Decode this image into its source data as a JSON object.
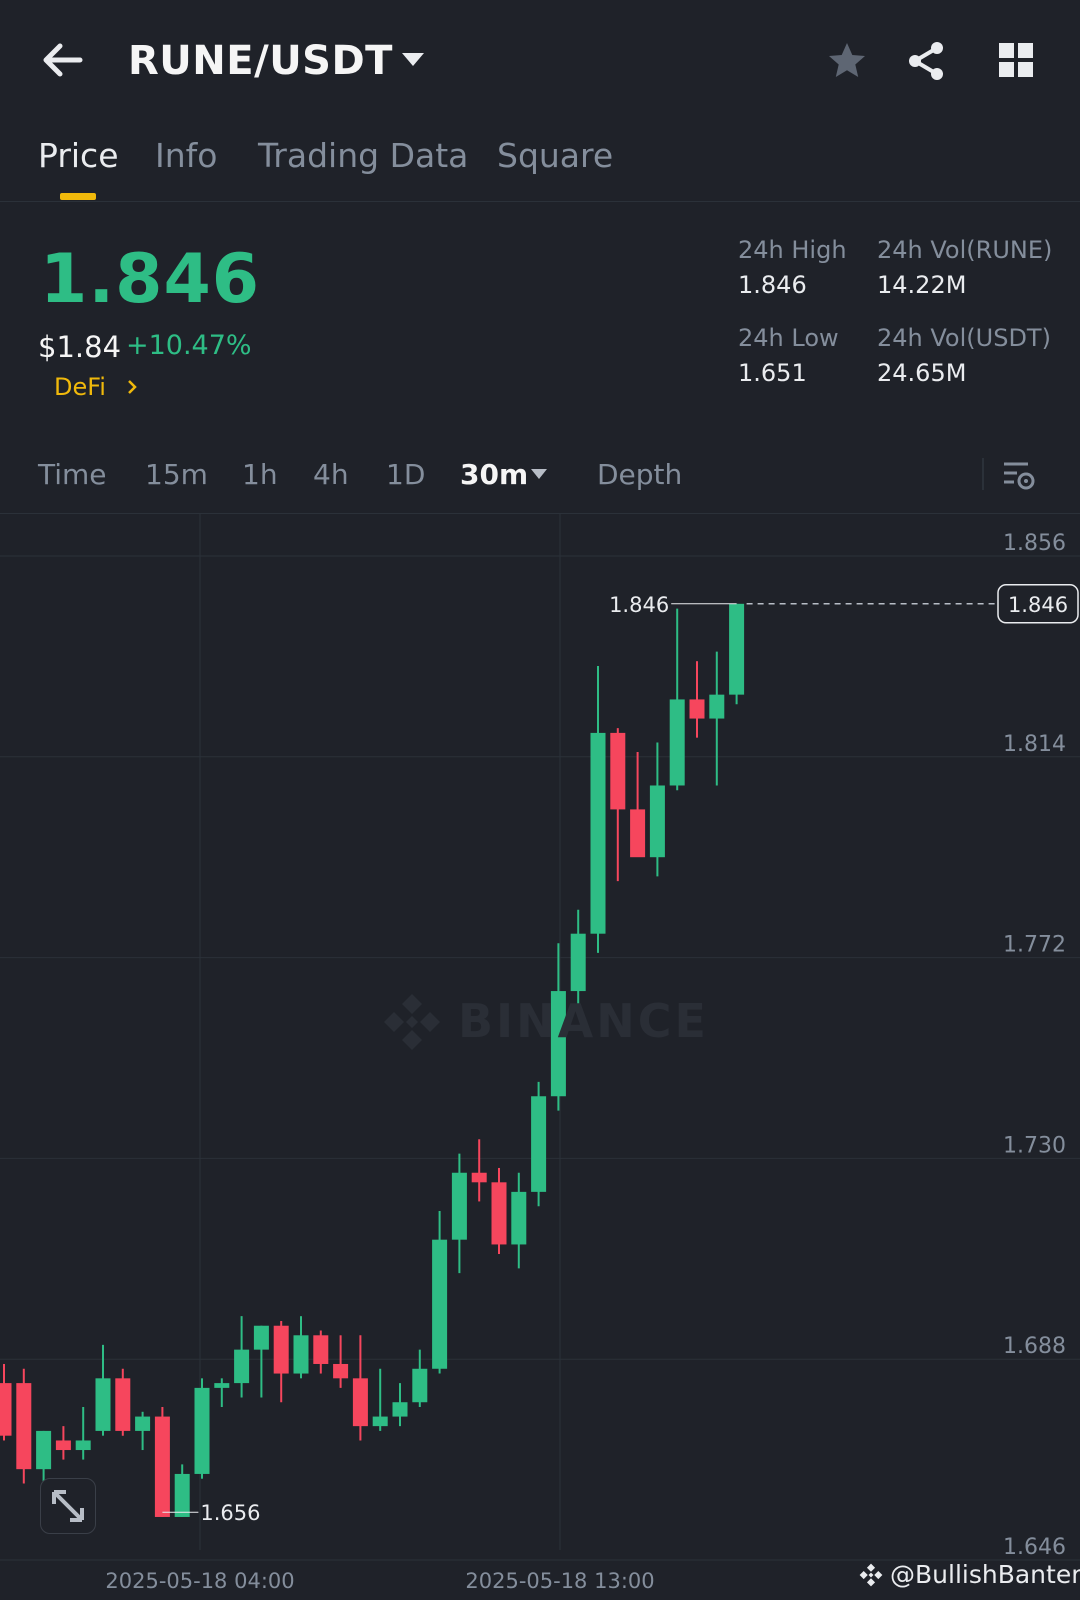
{
  "header": {
    "pair": "RUNE/USDT",
    "icons": [
      "back-arrow-icon",
      "caret-down-icon",
      "star-icon",
      "share-icon",
      "grid-icon"
    ]
  },
  "tabs": [
    {
      "label": "Price",
      "active": true
    },
    {
      "label": "Info",
      "active": false
    },
    {
      "label": "Trading Data",
      "active": false
    },
    {
      "label": "Square",
      "active": false
    }
  ],
  "price": {
    "last": "1.846",
    "usd": "$1.84",
    "change_pct": "+10.47%",
    "sector": "DeFi"
  },
  "stats": {
    "high_label": "24h High",
    "high_value": "1.846",
    "low_label": "24h Low",
    "low_value": "1.651",
    "vol_base_label": "24h Vol(RUNE)",
    "vol_base_value": "14.22M",
    "vol_quote_label": "24h Vol(USDT)",
    "vol_quote_value": "24.65M"
  },
  "intervals": {
    "time": "Time",
    "m15": "15m",
    "h1": "1h",
    "h4": "4h",
    "d1": "1D",
    "selected": "30m",
    "depth": "Depth"
  },
  "colors": {
    "up": "#2ebd85",
    "down": "#f6465d",
    "accent": "#f0b90b",
    "background": "#1f2229"
  },
  "watermark": "BINANCE",
  "credit": "@BullishBanter",
  "chart_data": {
    "type": "candlestick",
    "interval": "30m",
    "y_ticks": [
      "1.856",
      "1.814",
      "1.772",
      "1.730",
      "1.688",
      "1.646"
    ],
    "ylim": [
      1.646,
      1.856
    ],
    "x_labels": [
      "2025-05-18 04:00",
      "2025-05-18 13:00"
    ],
    "current_price_label": "1.846",
    "high_marker": "1.846",
    "low_marker": "1.656",
    "candles": [
      {
        "o": 1.683,
        "h": 1.687,
        "l": 1.671,
        "c": 1.672
      },
      {
        "o": 1.683,
        "h": 1.686,
        "l": 1.662,
        "c": 1.665
      },
      {
        "o": 1.665,
        "h": 1.673,
        "l": 1.661,
        "c": 1.673
      },
      {
        "o": 1.671,
        "h": 1.674,
        "l": 1.667,
        "c": 1.669
      },
      {
        "o": 1.669,
        "h": 1.678,
        "l": 1.667,
        "c": 1.671
      },
      {
        "o": 1.673,
        "h": 1.691,
        "l": 1.672,
        "c": 1.684
      },
      {
        "o": 1.684,
        "h": 1.686,
        "l": 1.672,
        "c": 1.673
      },
      {
        "o": 1.673,
        "h": 1.677,
        "l": 1.669,
        "c": 1.676
      },
      {
        "o": 1.676,
        "h": 1.678,
        "l": 1.655,
        "c": 1.655
      },
      {
        "o": 1.655,
        "h": 1.666,
        "l": 1.655,
        "c": 1.664
      },
      {
        "o": 1.664,
        "h": 1.684,
        "l": 1.663,
        "c": 1.682
      },
      {
        "o": 1.682,
        "h": 1.684,
        "l": 1.678,
        "c": 1.683
      },
      {
        "o": 1.683,
        "h": 1.697,
        "l": 1.68,
        "c": 1.69
      },
      {
        "o": 1.69,
        "h": 1.695,
        "l": 1.68,
        "c": 1.695
      },
      {
        "o": 1.695,
        "h": 1.696,
        "l": 1.679,
        "c": 1.685
      },
      {
        "o": 1.685,
        "h": 1.697,
        "l": 1.684,
        "c": 1.693
      },
      {
        "o": 1.693,
        "h": 1.694,
        "l": 1.685,
        "c": 1.687
      },
      {
        "o": 1.687,
        "h": 1.693,
        "l": 1.682,
        "c": 1.684
      },
      {
        "o": 1.684,
        "h": 1.693,
        "l": 1.671,
        "c": 1.674
      },
      {
        "o": 1.674,
        "h": 1.686,
        "l": 1.673,
        "c": 1.676
      },
      {
        "o": 1.676,
        "h": 1.683,
        "l": 1.674,
        "c": 1.679
      },
      {
        "o": 1.679,
        "h": 1.69,
        "l": 1.678,
        "c": 1.686
      },
      {
        "o": 1.686,
        "h": 1.719,
        "l": 1.685,
        "c": 1.713
      },
      {
        "o": 1.713,
        "h": 1.731,
        "l": 1.706,
        "c": 1.727
      },
      {
        "o": 1.727,
        "h": 1.734,
        "l": 1.721,
        "c": 1.725
      },
      {
        "o": 1.725,
        "h": 1.728,
        "l": 1.71,
        "c": 1.712
      },
      {
        "o": 1.712,
        "h": 1.727,
        "l": 1.707,
        "c": 1.723
      },
      {
        "o": 1.723,
        "h": 1.746,
        "l": 1.72,
        "c": 1.743
      },
      {
        "o": 1.743,
        "h": 1.775,
        "l": 1.74,
        "c": 1.765
      },
      {
        "o": 1.765,
        "h": 1.782,
        "l": 1.762,
        "c": 1.777
      },
      {
        "o": 1.777,
        "h": 1.833,
        "l": 1.773,
        "c": 1.819
      },
      {
        "o": 1.819,
        "h": 1.82,
        "l": 1.788,
        "c": 1.803
      },
      {
        "o": 1.803,
        "h": 1.815,
        "l": 1.798,
        "c": 1.793
      },
      {
        "o": 1.793,
        "h": 1.817,
        "l": 1.789,
        "c": 1.808
      },
      {
        "o": 1.808,
        "h": 1.845,
        "l": 1.807,
        "c": 1.826
      },
      {
        "o": 1.826,
        "h": 1.834,
        "l": 1.818,
        "c": 1.822
      },
      {
        "o": 1.822,
        "h": 1.836,
        "l": 1.808,
        "c": 1.827
      },
      {
        "o": 1.827,
        "h": 1.846,
        "l": 1.825,
        "c": 1.846
      }
    ]
  }
}
